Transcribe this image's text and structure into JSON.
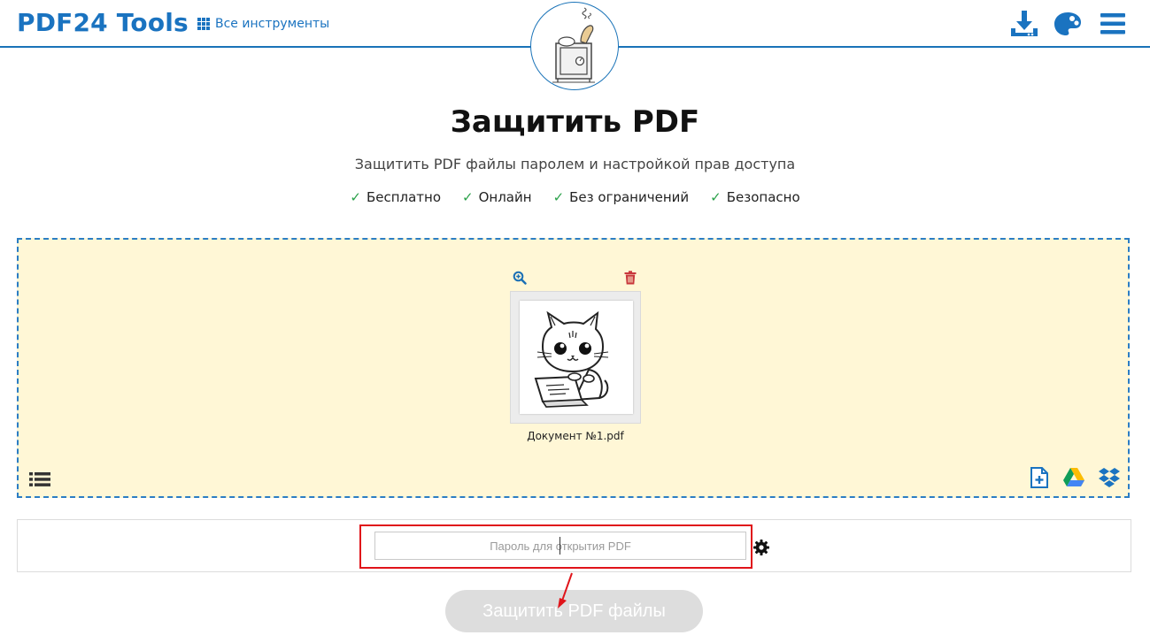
{
  "header": {
    "brand": "PDF24 Tools",
    "all_tools_label": "Все инструменты",
    "icons": [
      "download-icon",
      "palette-icon",
      "menu-icon"
    ],
    "accent_color": "#1a73c0"
  },
  "page": {
    "title": "Защитить PDF",
    "subtitle": "Защитить PDF файлы паролем и настройкой прав доступа",
    "features": [
      "Бесплатно",
      "Онлайн",
      "Без ограничений",
      "Безопасно"
    ],
    "check_mark": "✓"
  },
  "dropzone": {
    "background": "#fff7d6",
    "files": [
      {
        "name": "Документ №1.pdf",
        "thumbnail": "cat-with-laptop-drawing"
      }
    ],
    "icons": [
      "zoom-in-icon",
      "trash-icon",
      "list-view-icon",
      "add-file-icon",
      "google-drive-icon",
      "dropbox-icon"
    ]
  },
  "options": {
    "password_value": "",
    "password_placeholder": "Пароль для открытия PDF",
    "settings_icon": "gear-icon",
    "highlight_color": "#e0141a"
  },
  "action": {
    "submit_label": "Защитить PDF файлы"
  }
}
